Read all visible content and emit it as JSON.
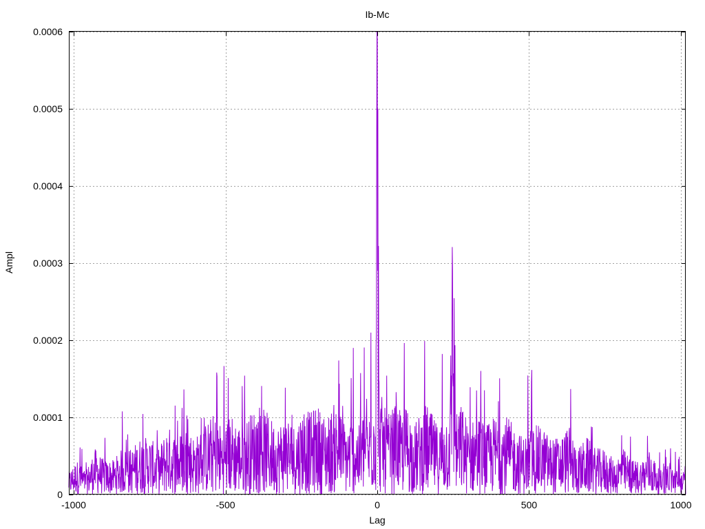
{
  "chart_data": {
    "type": "line",
    "title": "Ib-Mc",
    "xlabel": "Lag",
    "ylabel": "Ampl",
    "xlim": [
      -1016,
      1016
    ],
    "ylim": [
      0,
      0.0006
    ],
    "xticks": [
      -1000,
      -500,
      0,
      500,
      1000
    ],
    "xtick_labels": [
      "-1000",
      "-500",
      "0",
      "500",
      "1000"
    ],
    "yticks": [
      0,
      0.0001,
      0.0002,
      0.0003,
      0.0004,
      0.0005,
      0.0006
    ],
    "ytick_labels": [
      "0",
      "0.0001",
      "0.0002",
      "0.0003",
      "0.0004",
      "0.0005",
      "0.0006"
    ],
    "grid": true,
    "series": [
      {
        "color": "#9400d3",
        "x": [
          -1016,
          -990,
          -960,
          -930,
          -900,
          -870,
          -840,
          -810,
          -780,
          -750,
          -720,
          -690,
          -660,
          -630,
          -600,
          -570,
          -540,
          -510,
          -480,
          -450,
          -420,
          -390,
          -360,
          -330,
          -300,
          -270,
          -240,
          -220,
          -200,
          -180,
          -160,
          -140,
          -120,
          -100,
          -80,
          -60,
          -40,
          -30,
          -20,
          -10,
          -5,
          0,
          2,
          5,
          10,
          20,
          30,
          40,
          60,
          80,
          100,
          120,
          140,
          160,
          180,
          200,
          220,
          240,
          248,
          260,
          280,
          300,
          330,
          360,
          390,
          420,
          450,
          480,
          510,
          540,
          570,
          600,
          630,
          660,
          690,
          720,
          750,
          780,
          810,
          840,
          870,
          900,
          930,
          960,
          990,
          1016
        ],
        "y": [
          2e-05,
          3e-05,
          2e-05,
          4e-05,
          3e-05,
          3e-05,
          4e-05,
          4e-05,
          5e-05,
          5e-05,
          4e-05,
          6e-05,
          5e-05,
          6e-05,
          5e-05,
          6e-05,
          7e-05,
          6e-05,
          7e-05,
          6e-05,
          7e-05,
          8e-05,
          7e-05,
          6e-05,
          7e-05,
          6e-05,
          8e-05,
          7e-05,
          8e-05,
          7e-05,
          7e-05,
          8e-05,
          7e-05,
          6e-05,
          7e-05,
          6e-05,
          8e-05,
          6e-05,
          9e-05,
          0.0001,
          0.00011,
          0.00059,
          0.0005,
          0.00012,
          9e-05,
          8e-05,
          7e-05,
          7e-05,
          8e-05,
          7e-05,
          8e-05,
          6e-05,
          7e-05,
          8e-05,
          7e-05,
          6e-05,
          7e-05,
          8e-05,
          0.00029,
          7e-05,
          8e-05,
          6e-05,
          7e-05,
          6e-05,
          7e-05,
          7e-05,
          6e-05,
          5e-05,
          6e-05,
          6e-05,
          5e-05,
          5e-05,
          6e-05,
          4e-05,
          5e-05,
          4e-05,
          4e-05,
          3e-05,
          4e-05,
          3e-05,
          3e-05,
          4e-05,
          2e-05,
          3e-05,
          2e-05,
          2e-05
        ]
      }
    ]
  }
}
